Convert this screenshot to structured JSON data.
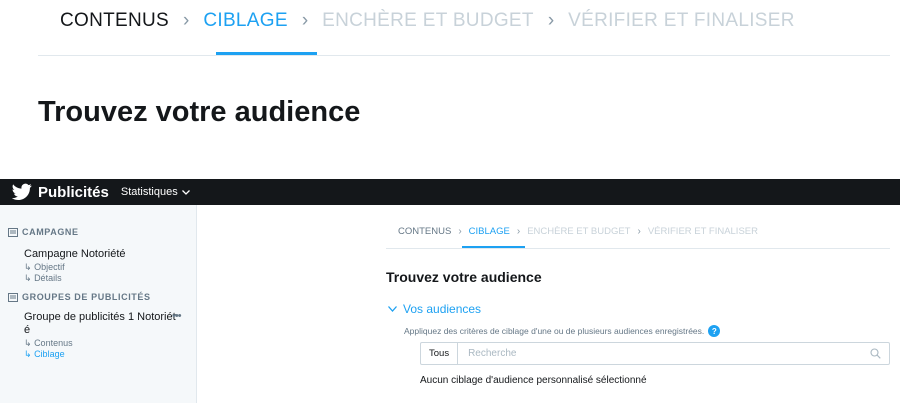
{
  "stepper_large": {
    "steps": [
      {
        "label": "CONTENUS",
        "state": "done"
      },
      {
        "label": "CIBLAGE",
        "state": "active"
      },
      {
        "label": "ENCHÈRE ET BUDGET",
        "state": "future"
      },
      {
        "label": "VÉRIFIER ET FINALISER",
        "state": "future"
      }
    ],
    "separator": "›"
  },
  "heading_large": "Trouvez votre audience",
  "topbar": {
    "brand": "Publicités",
    "stats_menu": "Statistiques",
    "icons": {
      "logo": "bird-icon",
      "menu": "chevron-down-icon"
    }
  },
  "sidebar": {
    "campaign_section": "CAMPAGNE",
    "campaign_name": "Campagne Notoriété",
    "campaign_items": [
      "Objectif",
      "Détails"
    ],
    "adgroups_section": "GROUPES DE PUBLICITÉS",
    "adgroup_name_line1": "Groupe de publicités 1 Notoriét",
    "adgroup_name_line2": "é",
    "adgroup_items": [
      "Contenus",
      "Ciblage"
    ],
    "active_item": "Ciblage",
    "item_prefix": "↳",
    "more_label": "•••"
  },
  "stepper_small": {
    "steps": [
      {
        "label": "CONTENUS",
        "state": "done"
      },
      {
        "label": "CIBLAGE",
        "state": "active"
      },
      {
        "label": "ENCHÈRE ET BUDGET",
        "state": "future"
      },
      {
        "label": "VÉRIFIER ET FINALISER",
        "state": "future"
      }
    ]
  },
  "main": {
    "heading": "Trouvez votre audience",
    "audiences_toggle": "Vos audiences",
    "help_text": "Appliquez des critères de ciblage d'une ou de plusieurs audiences enregistrées.",
    "help_icon": "?",
    "filter_label": "Tous",
    "search_placeholder": "Recherche",
    "empty_message": "Aucun ciblage d'audience personnalisé sélectionné"
  },
  "colors": {
    "accent": "#1da1f2",
    "topbar": "#14171a",
    "sidebar_bg": "#f5f8fa",
    "muted": "#657786",
    "inactive_step": "#c8d2d9"
  }
}
